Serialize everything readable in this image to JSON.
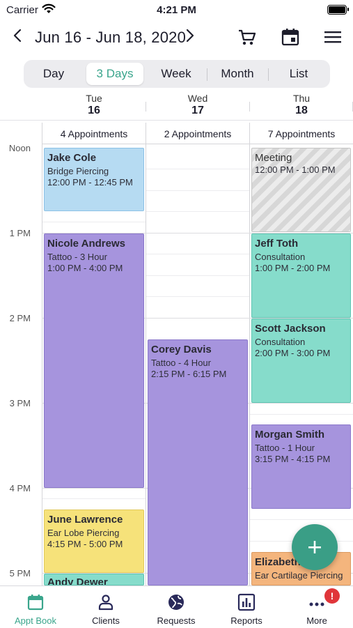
{
  "status_bar": {
    "carrier": "Carrier",
    "time": "4:21 PM"
  },
  "header": {
    "date_range": "Jun 16 - Jun 18, 2020"
  },
  "view_switcher": {
    "options": [
      "Day",
      "3 Days",
      "Week",
      "Month",
      "List"
    ],
    "selected": "3 Days"
  },
  "days": [
    {
      "name": "Tue",
      "date": "16",
      "count": "4 Appointments"
    },
    {
      "name": "Wed",
      "date": "17",
      "count": "2 Appointments"
    },
    {
      "name": "Thu",
      "date": "18",
      "count": "7 Appointments"
    }
  ],
  "time_labels": [
    "Noon",
    "1 PM",
    "2 PM",
    "3 PM",
    "4 PM",
    "5 PM"
  ],
  "events": {
    "tue_1": {
      "name": "Jake Cole",
      "service": "Bridge Piercing",
      "time": "12:00 PM - 12:45 PM"
    },
    "tue_2": {
      "name": "Nicole Andrews",
      "service": "Tattoo - 3 Hour",
      "time": "1:00 PM - 4:00 PM"
    },
    "tue_3": {
      "name": "June Lawrence",
      "service": "Ear Lobe Piercing",
      "time": "4:15 PM - 5:00 PM"
    },
    "tue_4": {
      "name": "Andy Dewer"
    },
    "wed_1": {
      "name": "Corey Davis",
      "service": "Tattoo - 4 Hour",
      "time": "2:15 PM - 6:15 PM"
    },
    "thu_1": {
      "name": "Meeting",
      "time": "12:00 PM - 1:00 PM"
    },
    "thu_2": {
      "name": "Jeff Toth",
      "service": "Consultation",
      "time": "1:00 PM - 2:00 PM"
    },
    "thu_3": {
      "name": "Scott Jackson",
      "service": "Consultation",
      "time": "2:00 PM - 3:00 PM"
    },
    "thu_4": {
      "name": "Morgan Smith",
      "service": "Tattoo - 1 Hour",
      "time": "3:15 PM - 4:15 PM"
    },
    "thu_5": {
      "name": "Elizabeth",
      "service": "Ear Cartilage Piercing"
    }
  },
  "fab": {
    "icon": "plus-icon"
  },
  "tabbar": {
    "items": [
      {
        "label": "Appt Book",
        "icon": "calendar-icon"
      },
      {
        "label": "Clients",
        "icon": "person-icon"
      },
      {
        "label": "Requests",
        "icon": "globe-icon"
      },
      {
        "label": "Reports",
        "icon": "bar-chart-icon"
      },
      {
        "label": "More",
        "icon": "more-icon"
      }
    ],
    "active": "Appt Book",
    "more_badge": "!"
  },
  "colors": {
    "accent": "#3aa58c",
    "blue_event": "#b6dbf2",
    "purple_event": "#a694dd",
    "yellow_event": "#f6e27a",
    "teal_event": "#86dccb",
    "orange_event": "#f4b57d",
    "badge": "#e0353a"
  }
}
